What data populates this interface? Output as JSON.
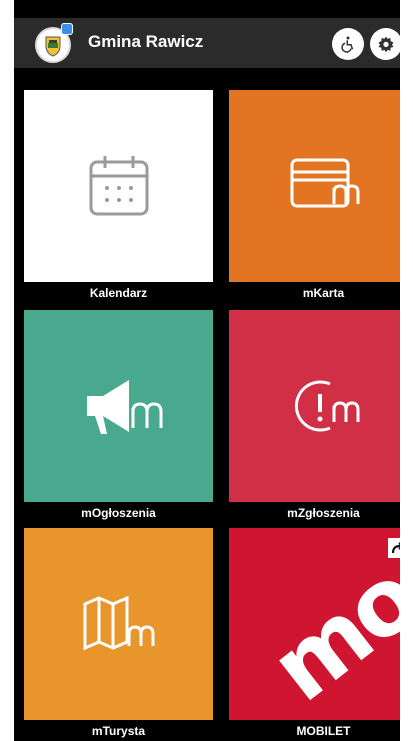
{
  "header": {
    "title": "Gmina Rawicz",
    "logo_icon": "coat-of-arms-icon",
    "accessibility_icon": "wheelchair-icon",
    "settings_icon": "gear-icon"
  },
  "tiles": [
    {
      "label": "Kalendarz",
      "icon": "calendar-icon",
      "color": "#ffffff"
    },
    {
      "label": "mKarta",
      "icon": "card-m-icon",
      "color": "#e37421"
    },
    {
      "label": "mOgłoszenia",
      "icon": "megaphone-m-icon",
      "color": "#49a98f"
    },
    {
      "label": "mZgłoszenia",
      "icon": "alert-m-icon",
      "color": "#d02f45"
    },
    {
      "label": "mTurysta",
      "icon": "map-m-icon",
      "color": "#e8952c"
    },
    {
      "label": "MOBILET",
      "icon": "external-link-icon",
      "color": "#cf1530",
      "brand_text": "mo"
    }
  ]
}
